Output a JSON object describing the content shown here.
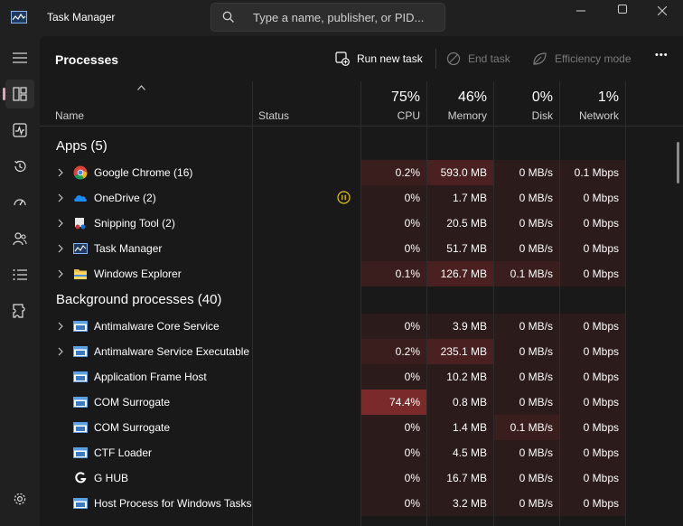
{
  "window": {
    "title": "Task Manager",
    "search_placeholder": "Type a name, publisher, or PID..."
  },
  "toolbar": {
    "page_title": "Processes",
    "run_new_task": "Run new task",
    "end_task": "End task",
    "efficiency_mode": "Efficiency mode",
    "more": "•••"
  },
  "columns": {
    "name": "Name",
    "status": "Status",
    "cpu_pct": "75%",
    "cpu": "CPU",
    "memory_pct": "46%",
    "memory": "Memory",
    "disk_pct": "0%",
    "disk": "Disk",
    "network_pct": "1%",
    "network": "Network"
  },
  "groups": {
    "apps": "Apps (5)",
    "background": "Background processes (40)"
  },
  "apps": [
    {
      "name": "Google Chrome (16)",
      "icon": "chrome-icon",
      "cpu": "0.2%",
      "memory": "593.0 MB",
      "disk": "0 MB/s",
      "network": "0.1 Mbps",
      "expandable": true
    },
    {
      "name": "OneDrive (2)",
      "icon": "onedrive-icon",
      "cpu": "0%",
      "memory": "1.7 MB",
      "disk": "0 MB/s",
      "network": "0 Mbps",
      "expandable": true,
      "status": "paused-icon"
    },
    {
      "name": "Snipping Tool (2)",
      "icon": "snipping-tool-icon",
      "cpu": "0%",
      "memory": "20.5 MB",
      "disk": "0 MB/s",
      "network": "0 Mbps",
      "expandable": true
    },
    {
      "name": "Task Manager",
      "icon": "task-manager-icon",
      "cpu": "0%",
      "memory": "51.7 MB",
      "disk": "0 MB/s",
      "network": "0 Mbps",
      "expandable": true
    },
    {
      "name": "Windows Explorer",
      "icon": "folder-icon",
      "cpu": "0.1%",
      "memory": "126.7 MB",
      "disk": "0.1 MB/s",
      "network": "0 Mbps",
      "expandable": true
    }
  ],
  "background": [
    {
      "name": "Antimalware Core Service",
      "icon": "service-window-icon",
      "cpu": "0%",
      "memory": "3.9 MB",
      "disk": "0 MB/s",
      "network": "0 Mbps",
      "expandable": true
    },
    {
      "name": "Antimalware Service Executable",
      "icon": "service-window-icon",
      "cpu": "0.2%",
      "memory": "235.1 MB",
      "disk": "0 MB/s",
      "network": "0 Mbps",
      "expandable": true
    },
    {
      "name": "Application Frame Host",
      "icon": "service-window-icon",
      "cpu": "0%",
      "memory": "10.2 MB",
      "disk": "0 MB/s",
      "network": "0 Mbps",
      "expandable": false
    },
    {
      "name": "COM Surrogate",
      "icon": "service-window-icon",
      "cpu": "74.4%",
      "memory": "0.8 MB",
      "disk": "0 MB/s",
      "network": "0 Mbps",
      "expandable": false
    },
    {
      "name": "COM Surrogate",
      "icon": "service-window-icon",
      "cpu": "0%",
      "memory": "1.4 MB",
      "disk": "0.1 MB/s",
      "network": "0 Mbps",
      "expandable": false
    },
    {
      "name": "CTF Loader",
      "icon": "service-window-icon",
      "cpu": "0%",
      "memory": "4.5 MB",
      "disk": "0 MB/s",
      "network": "0 Mbps",
      "expandable": false
    },
    {
      "name": "G HUB",
      "icon": "g-hub-icon",
      "cpu": "0%",
      "memory": "16.7 MB",
      "disk": "0 MB/s",
      "network": "0 Mbps",
      "expandable": false
    },
    {
      "name": "Host Process for Windows Tasks",
      "icon": "service-window-icon",
      "cpu": "0%",
      "memory": "3.2 MB",
      "disk": "0 MB/s",
      "network": "0 Mbps",
      "expandable": false
    }
  ],
  "colors": {
    "accent": "#e8a0b4",
    "heat_low": "#2c1b1b",
    "heat_med": "#4a2020",
    "heat_high": "#7a2a2a",
    "status_paused": "#e6c600"
  }
}
